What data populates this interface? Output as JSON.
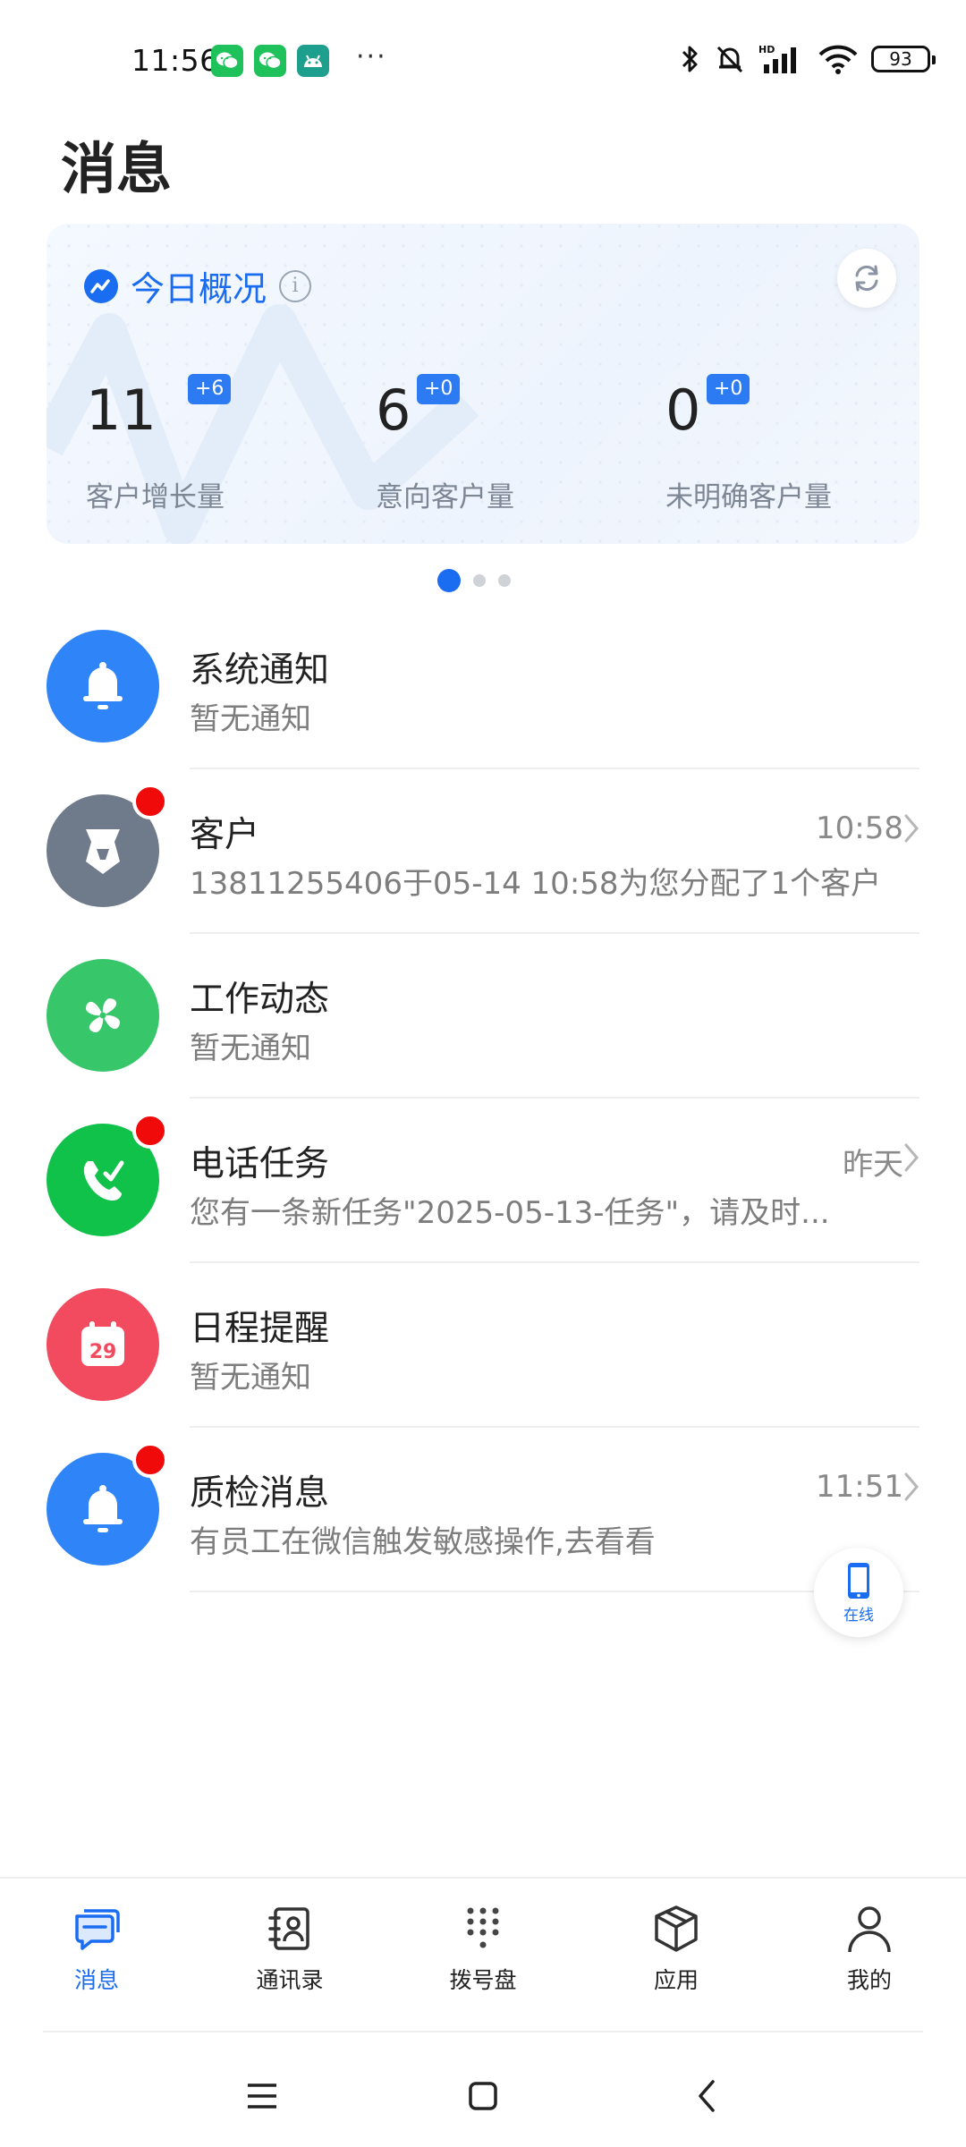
{
  "status_bar": {
    "time": "11:56",
    "notification_icons": [
      "wechat-icon",
      "wechat-icon",
      "android-icon"
    ],
    "more": "···",
    "battery": "93",
    "network_label": "HD"
  },
  "page_title": "消息",
  "overview": {
    "title": "今日概况",
    "stats": [
      {
        "value": "11",
        "delta": "+6",
        "label": "客户增长量"
      },
      {
        "value": "6",
        "delta": "+0",
        "label": "意向客户量"
      },
      {
        "value": "0",
        "delta": "+0",
        "label": "未明确客户量"
      }
    ],
    "pager": {
      "count": 3,
      "active": 0
    }
  },
  "messages": [
    {
      "title": "系统通知",
      "subtitle": "暂无通知",
      "time": "",
      "unread": false,
      "color": "#2f84f7",
      "icon": "bell-icon"
    },
    {
      "title": "客户",
      "subtitle": "13811255406于05-14 10:58为您分配了1个客户",
      "time": "10:58",
      "unread": true,
      "color": "#6f7a8a",
      "icon": "customer-tie-icon"
    },
    {
      "title": "工作动态",
      "subtitle": "暂无通知",
      "time": "",
      "unread": false,
      "color": "#38c66b",
      "icon": "pinwheel-icon"
    },
    {
      "title": "电话任务",
      "subtitle": "您有一条新任务\"2025-05-13-任务\"，请及时...",
      "time": "昨天",
      "unread": true,
      "color": "#10c24a",
      "icon": "phone-task-icon"
    },
    {
      "title": "日程提醒",
      "subtitle": "暂无通知",
      "time": "",
      "unread": false,
      "color": "#f24a5e",
      "icon": "calendar-icon",
      "calendar_day": "29"
    },
    {
      "title": "质检消息",
      "subtitle": "有员工在微信触发敏感操作,去看看",
      "time": "11:51",
      "unread": true,
      "color": "#2f84f7",
      "icon": "bell-icon"
    }
  ],
  "online_fab": {
    "label": "在线"
  },
  "tabs": [
    {
      "label": "消息",
      "icon": "message-icon",
      "active": true
    },
    {
      "label": "通讯录",
      "icon": "contacts-icon",
      "active": false
    },
    {
      "label": "拨号盘",
      "icon": "dialpad-icon",
      "active": false
    },
    {
      "label": "应用",
      "icon": "apps-cube-icon",
      "active": false
    },
    {
      "label": "我的",
      "icon": "profile-icon",
      "active": false
    }
  ],
  "colors": {
    "accent": "#1a6cf0",
    "badge": "#2c7bf2",
    "unread": "#f00a0a"
  }
}
